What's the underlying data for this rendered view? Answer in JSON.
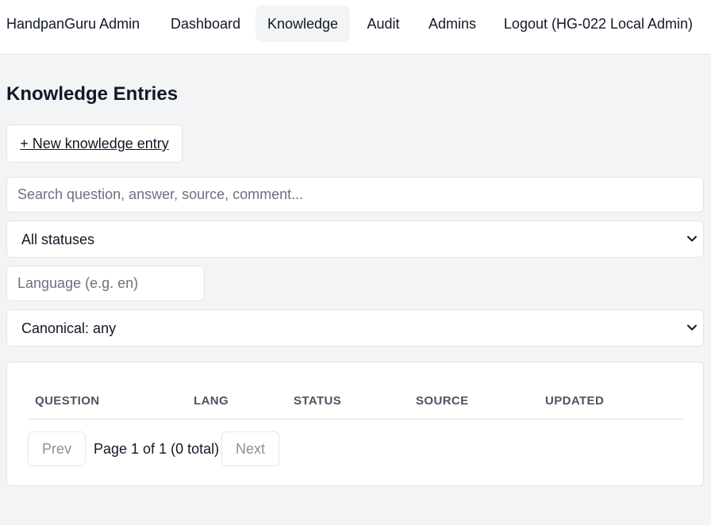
{
  "nav": {
    "brand": "HandpanGuru Admin",
    "links": [
      {
        "label": "Dashboard",
        "active": false
      },
      {
        "label": "Knowledge",
        "active": true
      },
      {
        "label": "Audit",
        "active": false
      },
      {
        "label": "Admins",
        "active": false
      },
      {
        "label": "Logout (HG-022 Local Admin)",
        "active": false
      }
    ]
  },
  "page": {
    "title": "Knowledge Entries",
    "new_button_label": "+ New knowledge entry"
  },
  "filters": {
    "search": {
      "placeholder": "Search question, answer, source, comment...",
      "value": ""
    },
    "status_select": {
      "value": "All statuses"
    },
    "language": {
      "placeholder": "Language (e.g. en)",
      "value": ""
    },
    "canonical_select": {
      "value": "Canonical: any"
    }
  },
  "table": {
    "columns": [
      "QUESTION",
      "LANG",
      "STATUS",
      "SOURCE",
      "UPDATED"
    ],
    "rows": []
  },
  "pagination": {
    "prev_label": "Prev",
    "next_label": "Next",
    "info": "Page 1 of 1 (0 total)"
  },
  "icons": {
    "select_chevron": "chevron-down-icon"
  }
}
